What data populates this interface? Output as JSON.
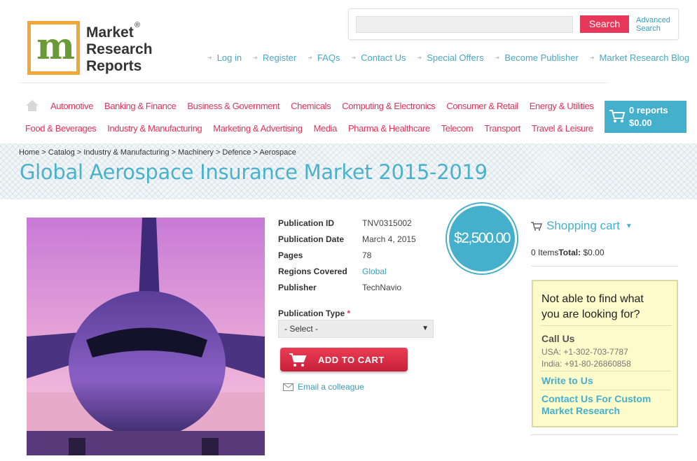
{
  "logo": {
    "line1": "Market",
    "line2": "Research",
    "line3": "Reports",
    "reg": "®"
  },
  "search": {
    "placeholder": "",
    "button": "Search",
    "advanced_line1": "Advanced",
    "advanced_line2": "Search"
  },
  "top_links": [
    "Log in",
    "Register",
    "FAQs",
    "Contact Us",
    "Special Offers",
    "Become Publisher",
    "Market Research Blog"
  ],
  "nav_row1": [
    "Automotive",
    "Banking & Finance",
    "Business & Government",
    "Chemicals",
    "Computing & Electronics",
    "Consumer & Retail",
    "Energy & Utilities"
  ],
  "nav_row2": [
    "Food & Beverages",
    "Industry & Manufacturing",
    "Marketing & Advertising",
    "Media",
    "Pharma & Healthcare",
    "Telecom",
    "Transport",
    "Travel & Leisure"
  ],
  "cart": {
    "reports": "0 reports",
    "amount": "$0.00"
  },
  "breadcrumb": "Home > Catalog > Industry & Manufacturing > Machinery > Defence > Aerospace",
  "title": "Global Aerospace Insurance Market 2015-2019",
  "details": {
    "publication_id_label": "Publication ID",
    "publication_id": "TNV0315002",
    "publication_date_label": "Publication Date",
    "publication_date": "March 4, 2015",
    "pages_label": "Pages",
    "pages": "78",
    "regions_label": "Regions Covered",
    "regions": "Global",
    "publisher_label": "Publisher",
    "publisher": "TechNavio"
  },
  "publication_type": {
    "label": "Publication Type",
    "required": "*",
    "selected": "- Select -"
  },
  "add_to_cart": "ADD TO CART",
  "email_colleague": "Email a colleague",
  "price": "$2,500.00",
  "shopping_cart": {
    "title": "Shopping cart",
    "items": "0 Items",
    "total_label": "Total:",
    "total": "$0.00"
  },
  "help": {
    "question_line1": "Not able to find what",
    "question_line2": "you are looking for?",
    "call_us": "Call Us",
    "usa": "USA: +1-302-703-7787",
    "india": "India: +91-80-26860858",
    "write": "Write to Us",
    "custom_line1": "Contact Us For Custom",
    "custom_line2": "Market Research"
  },
  "colors": {
    "accent": "#45b0cb",
    "nav": "#e0335a",
    "button": "#e8385a"
  }
}
